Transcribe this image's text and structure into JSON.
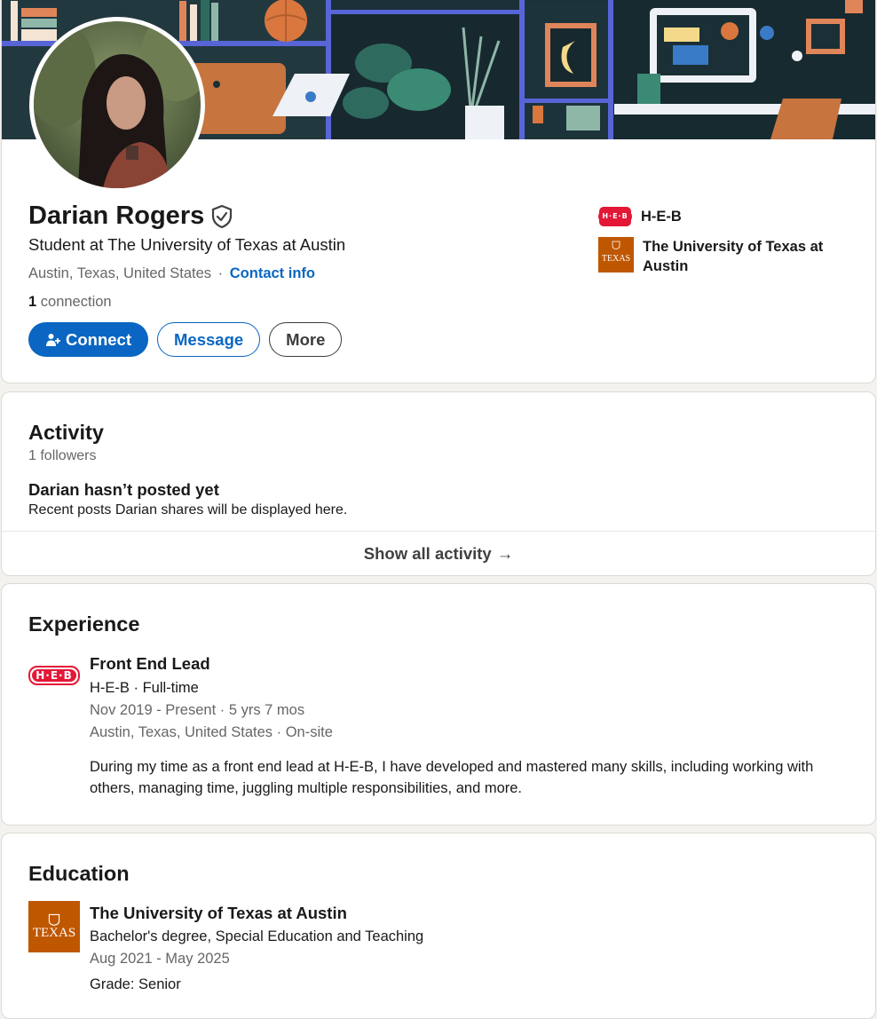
{
  "profile": {
    "name": "Darian Rogers",
    "headline": "Student at The University of Texas at Austin",
    "location": "Austin, Texas, United States",
    "location_separator": "·",
    "contact_info": "Contact info",
    "connections_count": "1",
    "connections_label": "connection",
    "buttons": {
      "connect": "Connect",
      "message": "Message",
      "more": "More"
    },
    "side_orgs": [
      {
        "name": "H-E-B",
        "logo": "heb-logo"
      },
      {
        "name": "The University of Texas at Austin",
        "logo": "texas-logo"
      }
    ]
  },
  "activity": {
    "title": "Activity",
    "followers": "1 followers",
    "empty_title": "Darian hasn’t posted yet",
    "empty_subtitle": "Recent posts Darian shares will be displayed here.",
    "show_all": "Show all activity",
    "show_all_arrow": "→"
  },
  "experience": {
    "title": "Experience",
    "items": [
      {
        "role": "Front End Lead",
        "company": "H-E-B · Full-time",
        "dates": "Nov 2019 - Present · 5 yrs 7 mos",
        "location": "Austin, Texas, United States · On-site",
        "description": "During my time as a front end lead at H-E-B, I have developed and mastered many skills, including working with others, managing time, juggling multiple responsibilities, and more."
      }
    ]
  },
  "education": {
    "title": "Education",
    "items": [
      {
        "school": "The University of Texas at Austin",
        "degree": "Bachelor's degree, Special Education and Teaching",
        "dates": "Aug 2021 - May 2025",
        "grade": "Grade: Senior"
      }
    ]
  },
  "logos": {
    "heb_text": "H·E·B",
    "texas_text": "TEXAS"
  },
  "colors": {
    "accent": "#0a66c2",
    "heb_red": "#e31837",
    "texas_orange": "#bf5700"
  }
}
